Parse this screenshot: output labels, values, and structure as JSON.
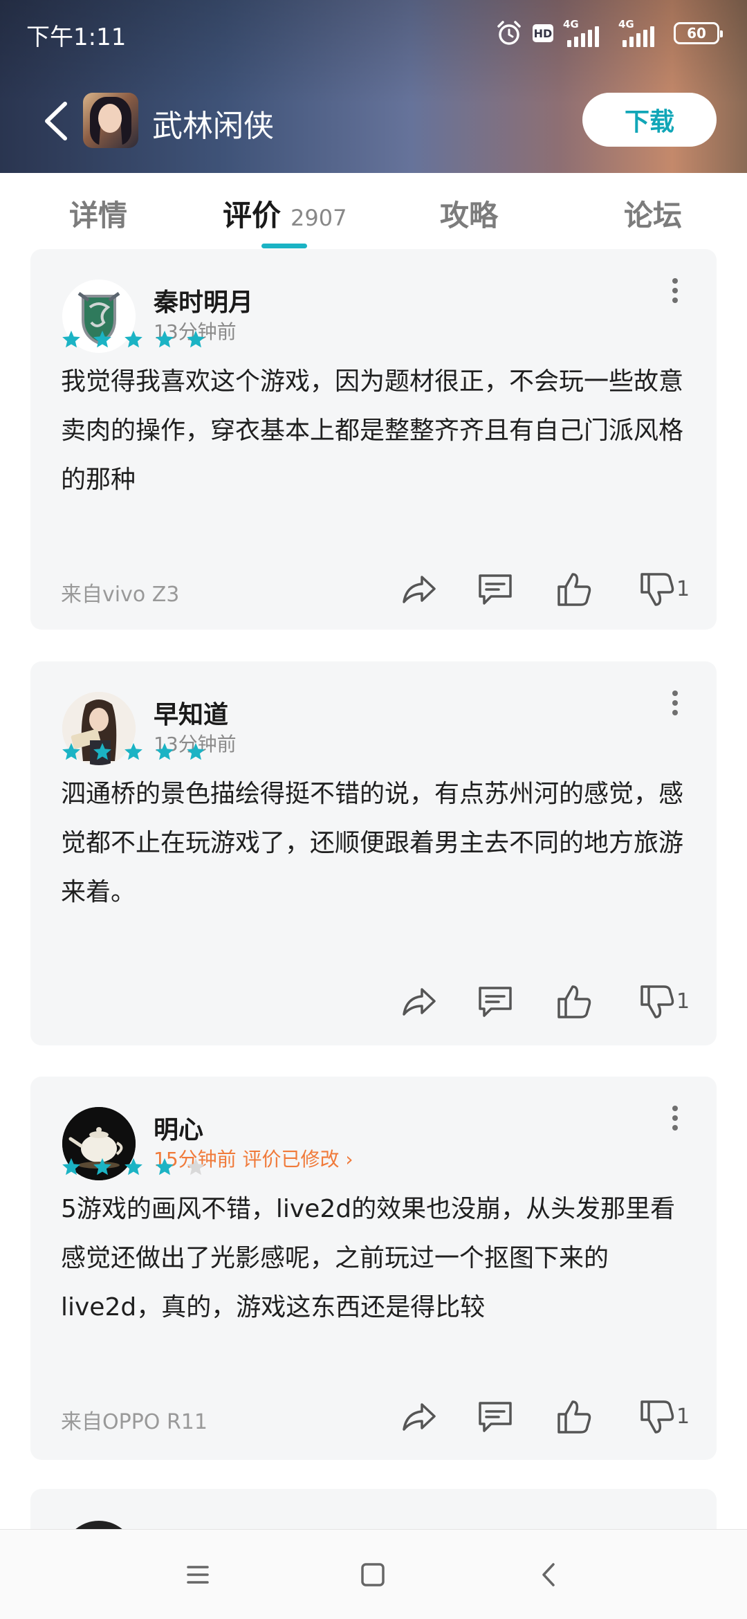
{
  "status_bar": {
    "time": "下午1:11",
    "hd": "HD",
    "net1": "4G",
    "net2": "4G",
    "battery": "60"
  },
  "header": {
    "app_title": "武林闲侠",
    "download_label": "下载"
  },
  "tabs": [
    {
      "label": "详情"
    },
    {
      "label": "评价",
      "count": "2907"
    },
    {
      "label": "攻略"
    },
    {
      "label": "论坛"
    }
  ],
  "colors": {
    "accent": "#1bb3c4",
    "star": "#1bb3c4",
    "star_empty": "#d9d9d9",
    "edited": "#f07a3a"
  },
  "reviews": [
    {
      "user": "秦时明月",
      "time": "13分钟前",
      "stars": 5,
      "content": "我觉得我喜欢这个游戏，因为题材很正，不会玩一些故意卖肉的操作，穿衣基本上都是整整齐齐且有自己门派风格的那种",
      "device": "来自vivo Z3",
      "dislikes": "1"
    },
    {
      "user": "早知道",
      "time": "13分钟前",
      "stars": 5,
      "content": "泗通桥的景色描绘得挺不错的说，有点苏州河的感觉，感觉都不止在玩游戏了，还顺便跟着男主去不同的地方旅游来着。",
      "device": "",
      "dislikes": "1"
    },
    {
      "user": "明心",
      "time": "15分钟前 评价已修改 ›",
      "stars": 4,
      "content": "5游戏的画风不错，live2d的效果也没崩，从头发那里看感觉还做出了光影感呢，之前玩过一个抠图下来的live2d，真的，游戏这东西还是得比较",
      "device": "来自OPPO R11",
      "dislikes": "1"
    }
  ],
  "icons": {
    "back": "chevron-left-icon",
    "share": "share-icon",
    "comment": "comment-icon",
    "like": "thumbs-up-icon",
    "dislike": "thumbs-down-icon",
    "more": "more-vertical-icon",
    "nav_menu": "menu-icon",
    "nav_home": "home-square-icon",
    "nav_back": "back-triangle-icon"
  }
}
